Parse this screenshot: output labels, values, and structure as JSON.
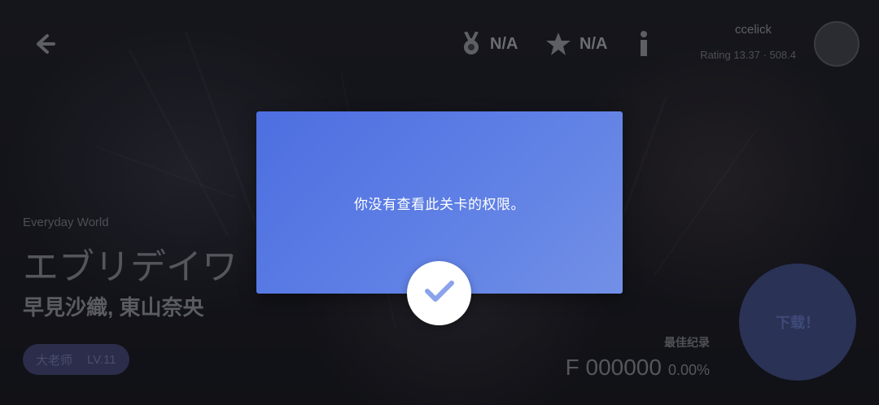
{
  "header": {
    "back_icon": "arrow-left-icon",
    "medal": {
      "icon": "medal-icon",
      "value": "N/A"
    },
    "star": {
      "icon": "star-icon",
      "value": "N/A"
    },
    "info_icon": "info-icon",
    "user": {
      "name": "ccelick",
      "rating": "Rating 13.37 · 508.4",
      "avatar_icon": "avatar-icon"
    }
  },
  "song": {
    "subtitle": "Everyday World",
    "title": "エブリデイワ",
    "artist": "早見沙織, 東山奈央",
    "difficulty": {
      "name": "大老师",
      "level": "LV.11"
    }
  },
  "record": {
    "label": "最佳纪录",
    "score": "F 000000",
    "accuracy": "0.00%"
  },
  "download_label": "下载！",
  "dialog": {
    "message": "你没有查看此关卡的权限。",
    "confirm_icon": "checkmark-icon"
  },
  "colors": {
    "dialog_gradient_start": "#4d6fe0",
    "dialog_gradient_end": "#7290e6",
    "confirm_check": "#8ba3ec"
  }
}
